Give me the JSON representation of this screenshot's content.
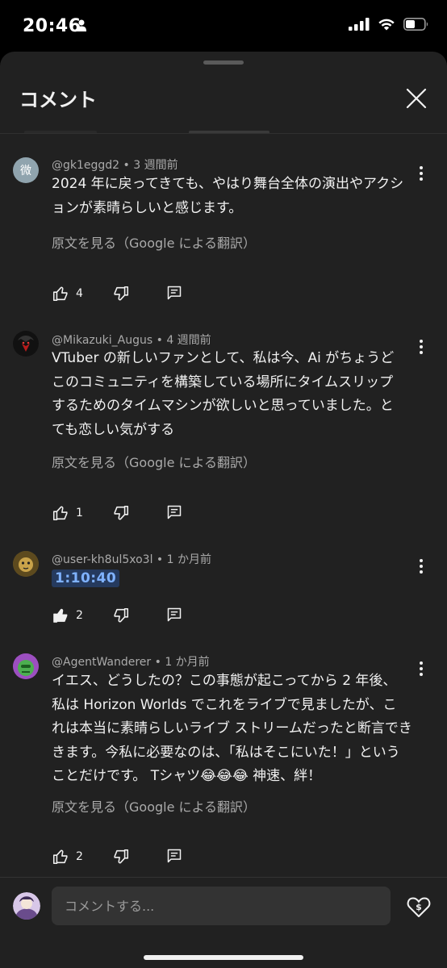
{
  "status_bar": {
    "time": "20:46"
  },
  "header": {
    "title": "コメント"
  },
  "comments": [
    {
      "avatar_char": "微",
      "avatar_color": "#90a4ae",
      "author": "@gk1eggd2",
      "age": "3 週間前",
      "text_lines": [
        "2024 年に戻ってきても、やはり舞台全体の演出やアクシ",
        "ョンが素晴らしいと感じます。"
      ],
      "translate_label": "原文を見る（Google による翻訳）",
      "like_count": "4"
    },
    {
      "author": "@Mikazuki_Augus",
      "age": "4 週間前",
      "text_lines": [
        "VTuber の新しいファンとして、私は今、Ai がちょうど",
        "このコミュニティを構築している場所にタイムスリップ",
        "するためのタイムマシンが欲しいと思っていました。と",
        "ても恋しい気がする"
      ],
      "translate_label": "原文を見る（Google による翻訳）",
      "like_count": "1"
    },
    {
      "author": "@user-kh8ul5xo3l",
      "age": "1 か月前",
      "timestamp": "1:10:40",
      "like_count": "2"
    },
    {
      "author": "@AgentWanderer",
      "age": "1 か月前",
      "text_lines": [
        "イエス、どうしたの？この事態が起こってから 2 年後、",
        "私は Horizon Worlds でこれをライブで見ましたが、こ",
        "れは本当に素晴らしいライブ ストリームだったと断言でき",
        "きます。今私に必要なのは、「私はそこにいた！」という",
        "ことだけです。 Tシャツ😂😂😂 神速、絆！"
      ],
      "translate_label": "原文を見る（Google による翻訳）",
      "like_count": "2"
    }
  ],
  "input": {
    "placeholder": "コメントする..."
  },
  "colors": {
    "background": "#212121",
    "text": "#f1f1f1",
    "secondary": "#aaaaaa",
    "link_bg": "#253a5e",
    "link_text": "#7fb2ff"
  }
}
